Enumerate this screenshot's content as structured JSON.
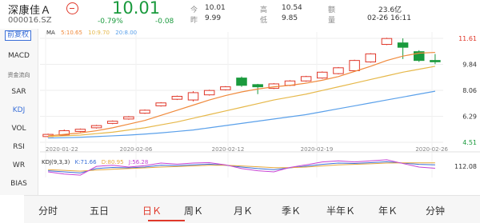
{
  "header": {
    "name": "深康佳Ａ",
    "code": "000016.SZ",
    "price": "10.01",
    "change_pct": "-0.79%",
    "change_abs": "-0.08",
    "quotes": [
      {
        "k1": "今",
        "v1": "10.01",
        "k2": "高",
        "v2": "10.54",
        "k3": "额",
        "v3": "23.6亿"
      },
      {
        "k1": "昨",
        "v1": "9.99",
        "k2": "低",
        "v2": "9.85",
        "k3": "量",
        "v3": "02-26 16:11"
      }
    ]
  },
  "side": {
    "fq": "前复权",
    "items": [
      "MACD",
      "资金流向",
      "SAR",
      "KDJ",
      "VOL",
      "RSI",
      "WR",
      "BIAS"
    ],
    "active": "KDJ"
  },
  "ma_legend": {
    "ma": "MA",
    "ma5": "5:10.65",
    "ma10": "10:9.70",
    "ma20": "20:8.00"
  },
  "kdj_legend": {
    "title": "KDJ(9,3,3)",
    "k": "K:71.66",
    "d": "D:80.95",
    "j": "J:56.28"
  },
  "chart_data": {
    "type": "candlestick",
    "price_labels": [
      "11.61",
      "9.84",
      "8.06",
      "6.29",
      "4.51"
    ],
    "price_range": [
      4.51,
      11.61
    ],
    "indicator_label": "112.08",
    "dates": [
      "2020-01-22",
      "2020-02-06",
      "2020-02-12",
      "2020-02-19",
      "2020-02-26"
    ],
    "candles": [
      {
        "open": 4.9,
        "close": 5.05,
        "high": 5.1,
        "low": 4.85
      },
      {
        "open": 5.0,
        "close": 5.3,
        "high": 5.38,
        "low": 4.95
      },
      {
        "open": 5.25,
        "close": 5.4,
        "high": 5.45,
        "low": 5.2
      },
      {
        "open": 5.5,
        "close": 5.65,
        "high": 5.7,
        "low": 5.45
      },
      {
        "open": 5.8,
        "close": 5.95,
        "high": 6.0,
        "low": 5.75
      },
      {
        "open": 6.1,
        "close": 6.25,
        "high": 6.3,
        "low": 6.05
      },
      {
        "open": 6.5,
        "close": 6.7,
        "high": 6.75,
        "low": 6.45
      },
      {
        "open": 7.0,
        "close": 7.2,
        "high": 7.25,
        "low": 6.95
      },
      {
        "open": 7.45,
        "close": 7.65,
        "high": 7.7,
        "low": 7.4
      },
      {
        "open": 7.4,
        "close": 7.9,
        "high": 8.0,
        "low": 7.3
      },
      {
        "open": 7.75,
        "close": 8.05,
        "high": 8.1,
        "low": 7.7
      },
      {
        "open": 8.1,
        "close": 8.3,
        "high": 8.35,
        "low": 8.05
      },
      {
        "open": 8.9,
        "close": 8.4,
        "high": 9.0,
        "low": 8.3
      },
      {
        "open": 8.45,
        "close": 8.3,
        "high": 8.5,
        "low": 7.8
      },
      {
        "open": 8.2,
        "close": 8.5,
        "high": 8.55,
        "low": 8.15
      },
      {
        "open": 8.4,
        "close": 8.7,
        "high": 8.75,
        "low": 8.35
      },
      {
        "open": 8.7,
        "close": 9.0,
        "high": 9.05,
        "low": 8.65
      },
      {
        "open": 8.9,
        "close": 9.3,
        "high": 9.35,
        "low": 8.85
      },
      {
        "open": 9.2,
        "close": 9.6,
        "high": 9.65,
        "low": 9.15
      },
      {
        "open": 9.4,
        "close": 10.1,
        "high": 10.15,
        "low": 9.35
      },
      {
        "open": 10.0,
        "close": 10.55,
        "high": 10.6,
        "low": 9.95
      },
      {
        "open": 11.2,
        "close": 11.6,
        "high": 11.65,
        "low": 11.15
      },
      {
        "open": 11.3,
        "close": 11.0,
        "high": 11.61,
        "low": 10.2
      },
      {
        "open": 10.7,
        "close": 10.1,
        "high": 10.8,
        "low": 10.0
      },
      {
        "open": 10.1,
        "close": 10.01,
        "high": 10.54,
        "low": 9.85
      }
    ],
    "series": [
      {
        "values": [
          4.95,
          5.05,
          5.15,
          5.3,
          5.5,
          5.75,
          6.0,
          6.35,
          6.7,
          7.05,
          7.4,
          7.7,
          7.95,
          8.15,
          8.3,
          8.4,
          8.55,
          8.75,
          9.0,
          9.35,
          9.7,
          10.1,
          10.4,
          10.6,
          10.65
        ]
      },
      {
        "values": [
          4.9,
          4.95,
          5.0,
          5.1,
          5.2,
          5.35,
          5.5,
          5.7,
          5.9,
          6.15,
          6.4,
          6.65,
          6.9,
          7.15,
          7.4,
          7.6,
          7.8,
          8.05,
          8.3,
          8.55,
          8.8,
          9.05,
          9.3,
          9.5,
          9.7
        ]
      },
      {
        "values": [
          4.8,
          4.82,
          4.85,
          4.9,
          4.95,
          5.0,
          5.07,
          5.15,
          5.25,
          5.35,
          5.5,
          5.65,
          5.8,
          5.95,
          6.1,
          6.25,
          6.4,
          6.6,
          6.8,
          7.0,
          7.2,
          7.4,
          7.6,
          7.8,
          8.0
        ]
      }
    ],
    "kdj": {
      "k": [
        45,
        40,
        35,
        55,
        60,
        58,
        62,
        70,
        68,
        72,
        75,
        70,
        62,
        55,
        50,
        58,
        66,
        74,
        80,
        78,
        82,
        86,
        80,
        74,
        71.66
      ],
      "d": [
        50,
        47,
        43,
        48,
        52,
        55,
        58,
        62,
        64,
        67,
        70,
        70,
        67,
        63,
        59,
        59,
        62,
        67,
        72,
        74,
        77,
        80,
        81,
        81,
        80.95
      ],
      "j": [
        40,
        30,
        25,
        65,
        70,
        62,
        68,
        80,
        75,
        80,
        82,
        72,
        55,
        45,
        40,
        60,
        72,
        85,
        90,
        85,
        90,
        95,
        78,
        62,
        56.28
      ]
    },
    "colors": {
      "up": "#e0392b",
      "down": "#1a9a3d",
      "ma5": "#f08a3c",
      "ma10": "#e6b84a",
      "ma20": "#5aa0ea",
      "k": "#3a6fd8",
      "d": "#e6a83c",
      "j": "#c743d4"
    }
  },
  "tabs": {
    "items": [
      "分时",
      "五日",
      "日Ｋ",
      "周Ｋ",
      "月Ｋ",
      "季Ｋ",
      "半年Ｋ",
      "年Ｋ",
      "分钟"
    ],
    "active": "日Ｋ"
  }
}
